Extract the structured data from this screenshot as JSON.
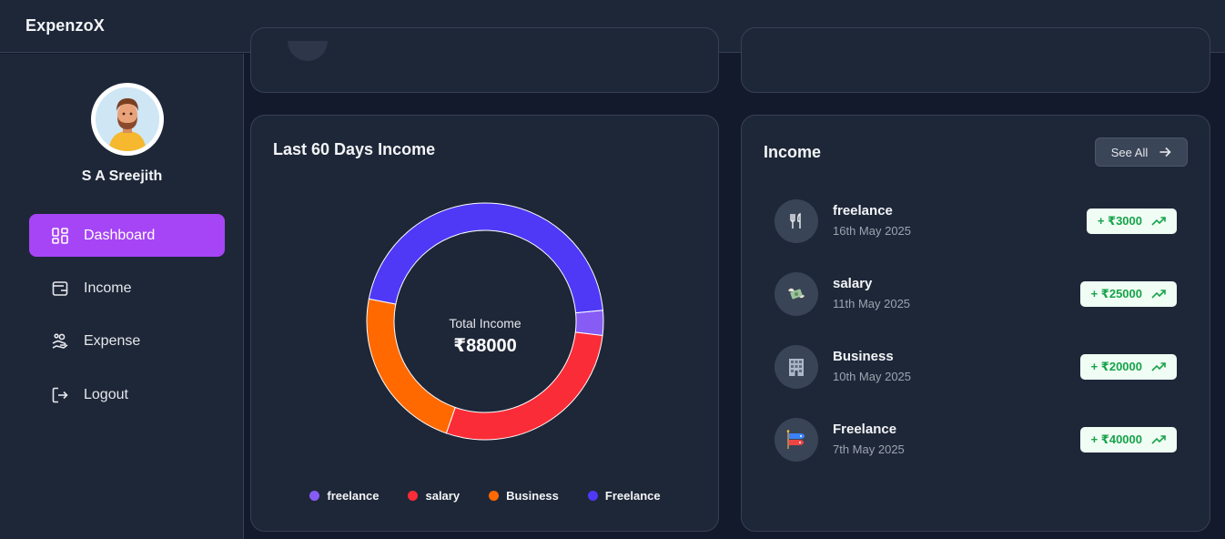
{
  "app": {
    "title": "ExpenzoX"
  },
  "user": {
    "name": "S A Sreejith"
  },
  "sidebar": {
    "items": [
      {
        "label": "Dashboard",
        "icon": "dashboard-icon",
        "active": true
      },
      {
        "label": "Income",
        "icon": "wallet-icon",
        "active": false
      },
      {
        "label": "Expense",
        "icon": "hand-coins-icon",
        "active": false
      },
      {
        "label": "Logout",
        "icon": "logout-icon",
        "active": false
      }
    ]
  },
  "income_chart": {
    "title": "Last 60 Days Income",
    "center_label": "Total Income",
    "center_value": "₹88000"
  },
  "chart_data": {
    "type": "pie",
    "categories": [
      "freelance",
      "salary",
      "Business",
      "Freelance"
    ],
    "values": [
      3000,
      25000,
      20000,
      40000
    ],
    "colors": [
      "#875cf5",
      "#fa2c37",
      "#ff6900",
      "#4f39f6"
    ],
    "title": "Last 60 Days Income",
    "legend_position": "bottom"
  },
  "income_list": {
    "title": "Income",
    "see_all_label": "See All",
    "items": [
      {
        "name": "freelance",
        "date": "16th May 2025",
        "amount": "+ ₹3000",
        "icon": "utensils-icon"
      },
      {
        "name": "salary",
        "date": "11th May 2025",
        "amount": "+ ₹25000",
        "icon": "money-with-wings-icon"
      },
      {
        "name": "Business",
        "date": "10th May 2025",
        "amount": "+ ₹20000",
        "icon": "office-building-icon"
      },
      {
        "name": "Freelance",
        "date": "7th May 2025",
        "amount": "+ ₹40000",
        "icon": "carp-streamer-icon"
      }
    ]
  }
}
